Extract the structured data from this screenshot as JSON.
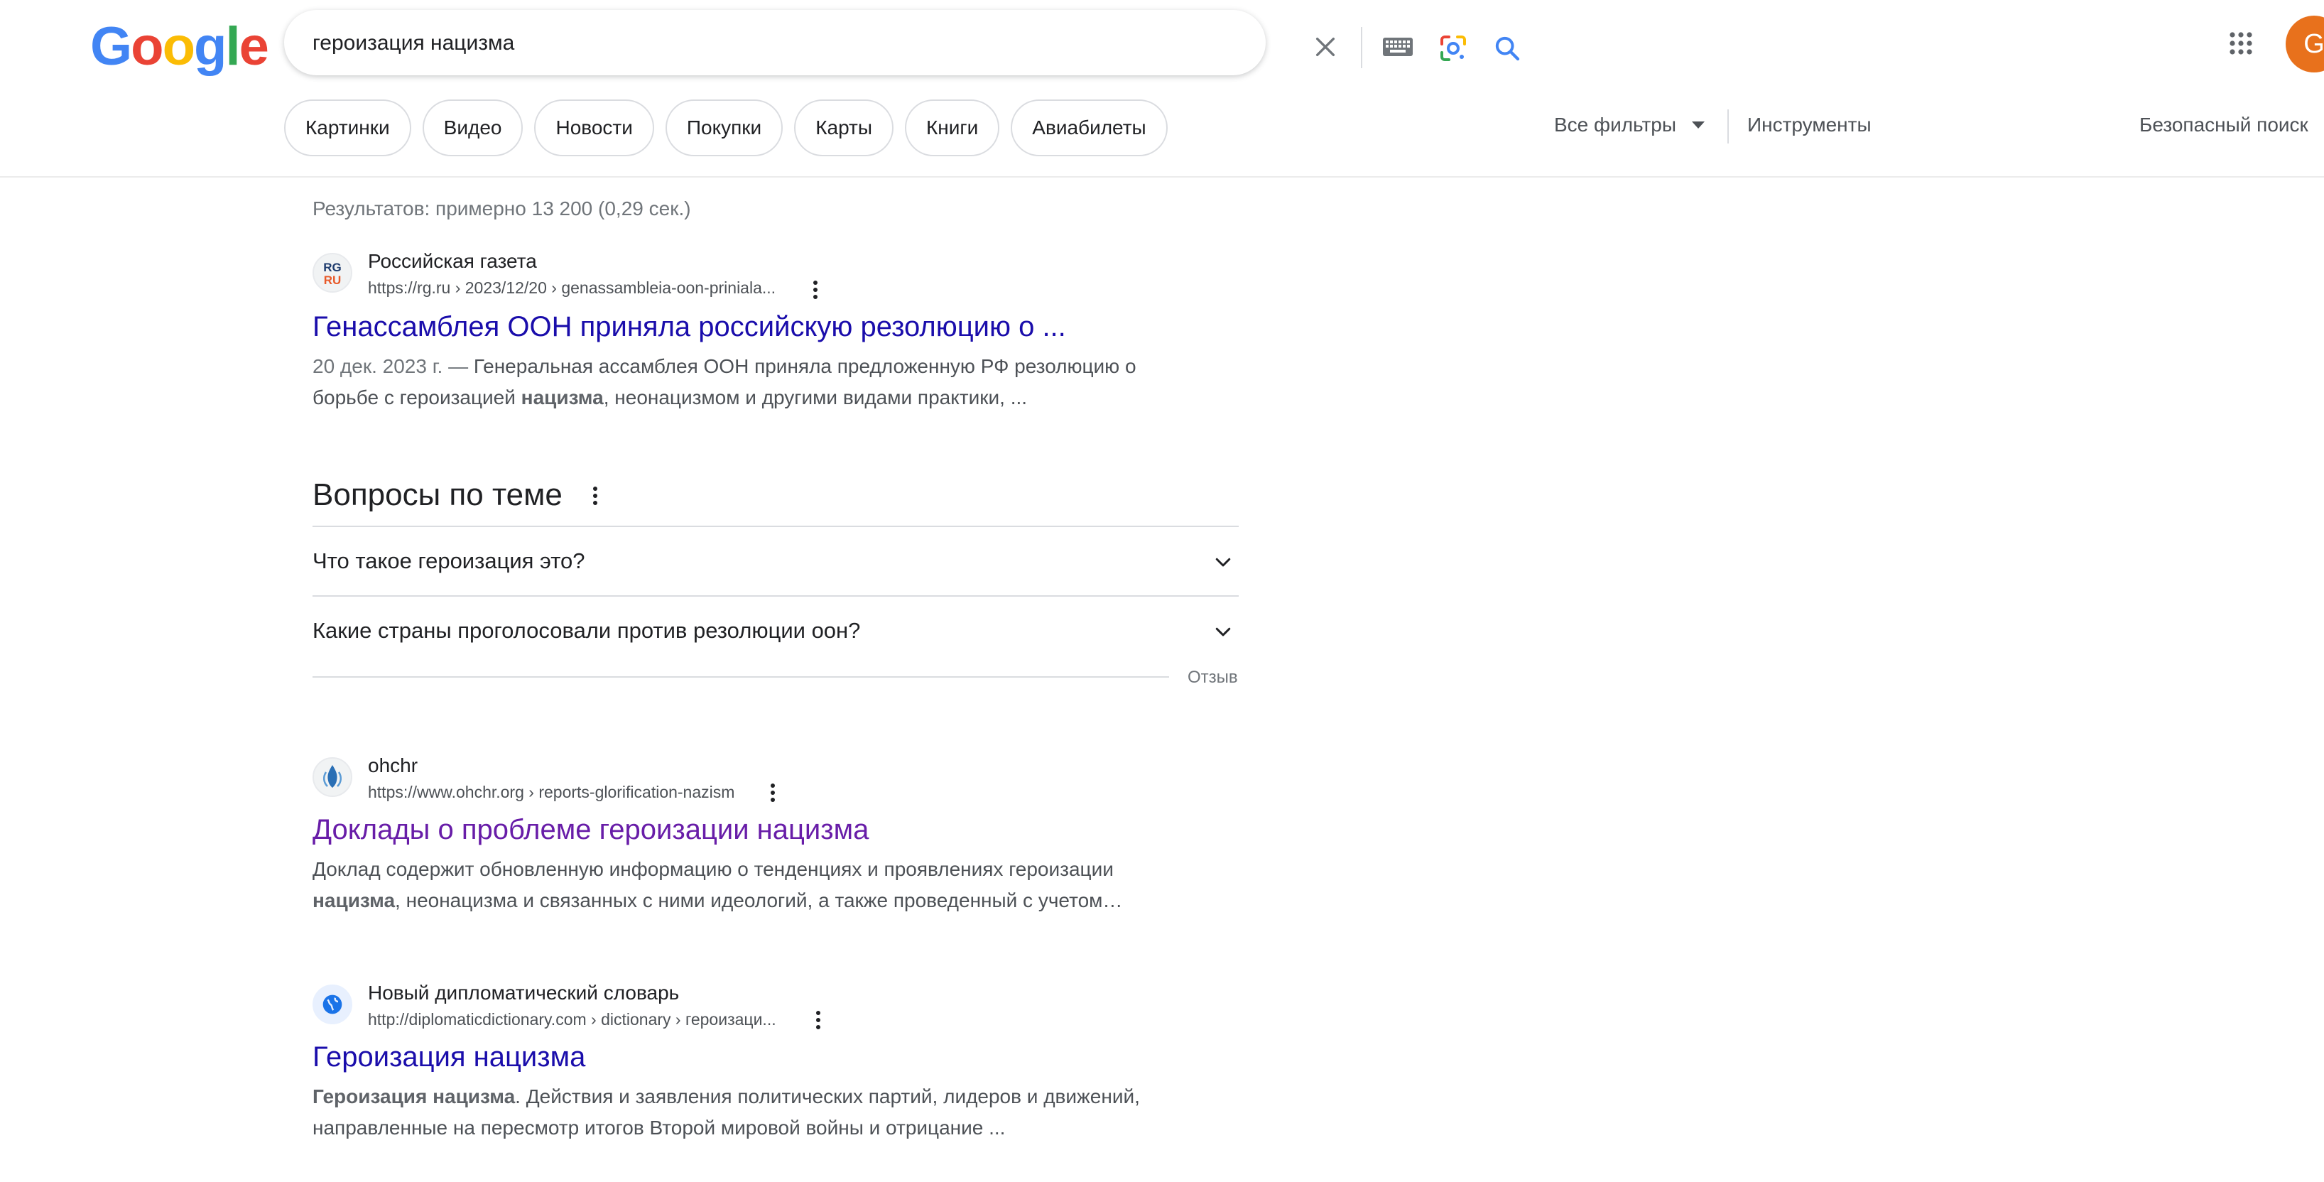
{
  "header": {
    "logo_letters": [
      {
        "char": "G",
        "color": "#4285F4"
      },
      {
        "char": "o",
        "color": "#EA4335"
      },
      {
        "char": "o",
        "color": "#FBBC05"
      },
      {
        "char": "g",
        "color": "#4285F4"
      },
      {
        "char": "l",
        "color": "#34A853"
      },
      {
        "char": "e",
        "color": "#EA4335"
      }
    ],
    "search_query": "героизация нацизма",
    "avatar_letter": "G",
    "avatar_color": "#e8711c"
  },
  "chips": [
    "Картинки",
    "Видео",
    "Новости",
    "Покупки",
    "Карты",
    "Книги",
    "Авиабилеты"
  ],
  "filters": {
    "all_filters": "Все фильтры",
    "tools": "Инструменты",
    "safe_search": "Безопасный поиск"
  },
  "stats": "Результатов: примерно 13 200 (0,29 сек.)",
  "results": [
    {
      "site_name": "Российская газета",
      "url": "https://rg.ru › 2023/12/20 › genassambleia-oon-priniala...",
      "favicon_text": "RG RU",
      "title": "Генассамблея ООН приняла российскую резолюцию о ...",
      "date": "20 дек. 2023 г. —",
      "snippet_part1": " Генеральная ассамблея ООН приняла предложенную РФ резолюцию о борьбе с героизацией ",
      "snippet_bold": "нацизма",
      "snippet_part2": ", неонацизмом и другими видами практики, ..."
    },
    {
      "site_name": "ohchr",
      "url": "https://www.ohchr.org › reports-glorification-nazism",
      "title": "Доклады о проблеме героизации нацизма",
      "snippet_part1": "Доклад содержит обновленную информацию о тенденциях и проявлениях героизации ",
      "snippet_bold": "нацизма",
      "snippet_part2": ", неонацизма и связанных с ними идеологий, а также проведенный с учетом…"
    },
    {
      "site_name": "Новый дипломатический словарь",
      "url": "http://diplomaticdictionary.com › dictionary › героизаци...",
      "title": "Героизация нацизма",
      "snippet_bold": "Героизация нацизма",
      "snippet_part2": ". Действия и заявления политических партий, лидеров и движений, направленные на пересмотр итогов Второй мировой войны и отрицание ..."
    }
  ],
  "paa": {
    "title": "Вопросы по теме",
    "questions": [
      "Что такое героизация это?",
      "Какие страны проголосовали против резолюции оон?"
    ],
    "feedback": "Отзыв"
  },
  "colors": {
    "link": "#1a0dab",
    "visited_link": "#681da8",
    "snippet": "#4d5156"
  }
}
